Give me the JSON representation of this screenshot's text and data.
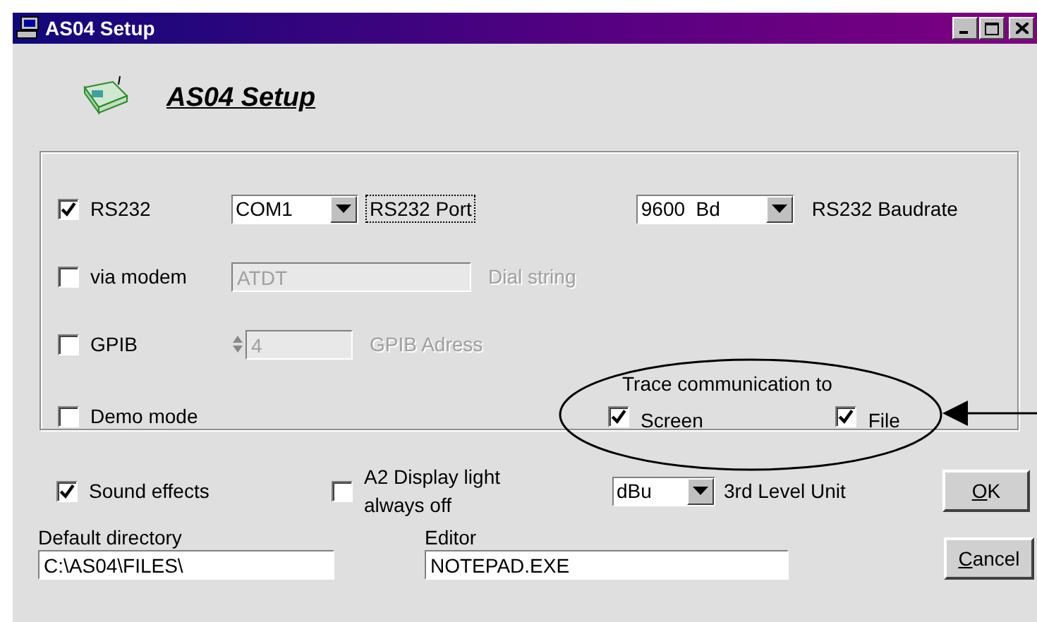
{
  "window": {
    "title": "AS04 Setup"
  },
  "header": {
    "title": "AS04 Setup"
  },
  "connection": {
    "rs232": {
      "label": "RS232",
      "checked": true,
      "port": {
        "value": "COM1",
        "label": "RS232 Port"
      },
      "baudrate": {
        "value": "9600  Bd",
        "label": "RS232 Baudrate"
      }
    },
    "modem": {
      "label": "via modem",
      "checked": false,
      "dial_string": {
        "value": "ATDT",
        "label": "Dial string",
        "disabled": true
      }
    },
    "gpib": {
      "label": "GPIB",
      "checked": false,
      "address": {
        "value": "4",
        "label": "GPIB Adress",
        "disabled": true
      }
    },
    "demo": {
      "label": "Demo mode",
      "checked": false
    },
    "trace": {
      "label": "Trace communication to",
      "screen": {
        "label": "Screen",
        "checked": true
      },
      "file": {
        "label": "File",
        "checked": true
      }
    }
  },
  "options": {
    "sound": {
      "label": "Sound effects",
      "checked": true
    },
    "display_light": {
      "label": "A2 Display light always off",
      "checked": false
    },
    "level_unit": {
      "value": "dBu",
      "label": "3rd Level Unit"
    }
  },
  "default_directory": {
    "label": "Default directory",
    "value": "C:\\AS04\\FILES\\"
  },
  "editor": {
    "label": "Editor",
    "value": "NOTEPAD.EXE"
  },
  "buttons": [
    {
      "label": "OK"
    },
    {
      "label": "Cancel"
    }
  ]
}
